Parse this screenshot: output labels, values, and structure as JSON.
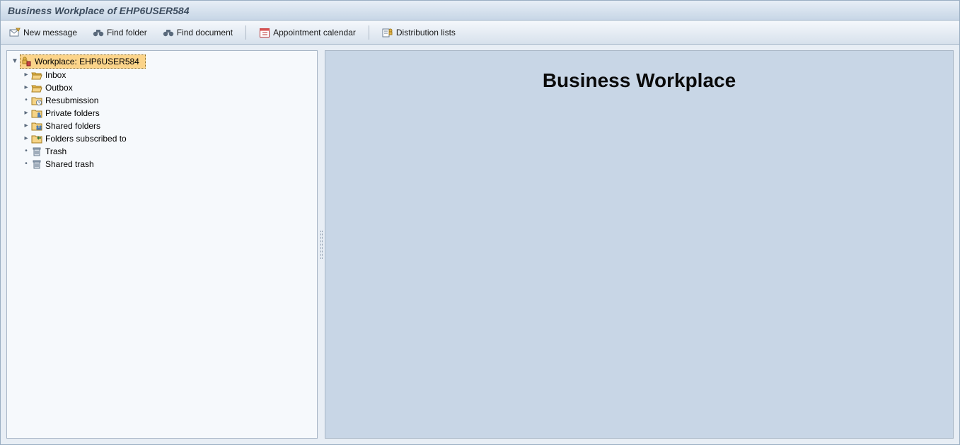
{
  "title": "Business Workplace of EHP6USER584",
  "toolbar": {
    "new_message": "New message",
    "find_folder": "Find folder",
    "find_document": "Find document",
    "appointment_calendar": "Appointment calendar",
    "distribution_lists": "Distribution lists"
  },
  "tree": {
    "root": {
      "label": "Workplace: EHP6USER584",
      "expanded": true
    },
    "items": [
      {
        "label": "Inbox",
        "icon": "folder-open",
        "expandable": true
      },
      {
        "label": "Outbox",
        "icon": "folder-open",
        "expandable": true
      },
      {
        "label": "Resubmission",
        "icon": "folder-clock",
        "expandable": false
      },
      {
        "label": "Private folders",
        "icon": "folder-private",
        "expandable": true
      },
      {
        "label": "Shared folders",
        "icon": "folder-shared",
        "expandable": true
      },
      {
        "label": "Folders subscribed to",
        "icon": "folder-sub",
        "expandable": true
      },
      {
        "label": "Trash",
        "icon": "trash",
        "expandable": false
      },
      {
        "label": "Shared trash",
        "icon": "trash",
        "expandable": false
      }
    ]
  },
  "content": {
    "header": "Business Workplace"
  }
}
